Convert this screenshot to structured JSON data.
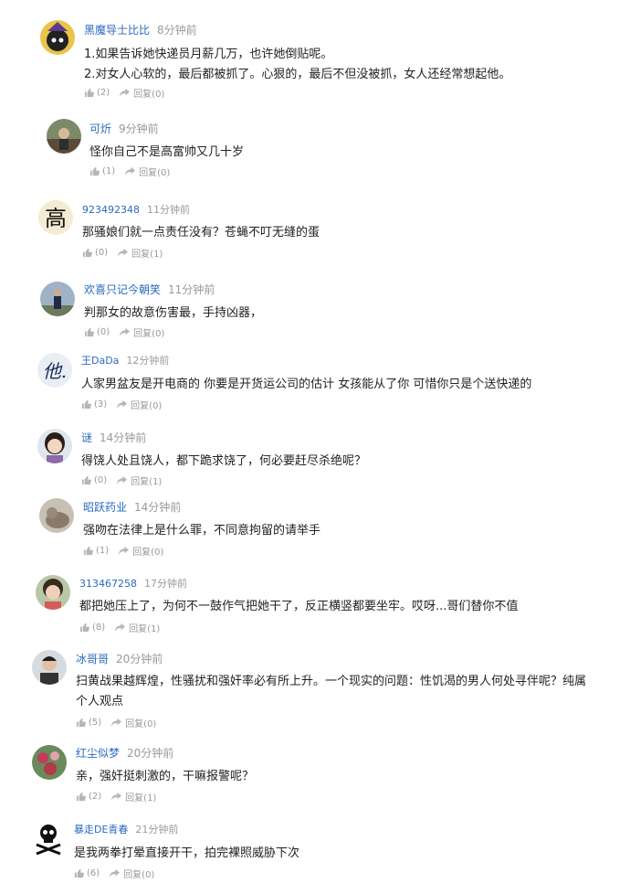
{
  "comments": [
    {
      "user": "黑魔导士比比",
      "time": "8分钟前",
      "lines": [
        "1.如果告诉她快递员月薪几万，也许她倒贴呢。",
        "2.对女人心软的，最后都被抓了。心狠的，最后不但没被抓，女人还经常想起他。"
      ],
      "likes": "(2)",
      "reply": "回复(0)",
      "avatar": "wizard"
    },
    {
      "user": "可炘",
      "time": "9分钟前",
      "lines": [
        "怪你自己不是高富帅又几十岁"
      ],
      "likes": "(1)",
      "reply": "回复(0)",
      "avatar": "photo"
    },
    {
      "user": "923492348",
      "time": "11分钟前",
      "lines": [
        "那骚娘们就一点责任没有？苍蝇不叮无缝的蛋"
      ],
      "likes": "(0)",
      "reply": "回复(1)",
      "avatar": "gao"
    },
    {
      "user": "欢喜只记今朝笑",
      "time": "11分钟前",
      "lines": [
        "判那女的故意伤害最，手持凶器，"
      ],
      "likes": "(0)",
      "reply": "回复(0)",
      "avatar": "person"
    },
    {
      "user": "王DaDa",
      "time": "12分钟前",
      "lines": [
        "人家男盆友是开电商的 你要是开货运公司的估计 女孩能从了你 可惜你只是个送快递的"
      ],
      "likes": "(3)",
      "reply": "回复(0)",
      "avatar": "ta"
    },
    {
      "user": "谜",
      "time": "14分钟前",
      "lines": [
        "得饶人处且饶人，都下跪求饶了，何必要赶尽杀绝呢？"
      ],
      "likes": "(0)",
      "reply": "回复(1)",
      "avatar": "girl"
    },
    {
      "user": "昭跃药业",
      "time": "14分钟前",
      "lines": [
        "强吻在法律上是什么罪，不同意拘留的请举手"
      ],
      "likes": "(1)",
      "reply": "回复(0)",
      "avatar": "cat"
    },
    {
      "user": "313467258",
      "time": "17分钟前",
      "lines": [
        "都把她压上了，为何不一鼓作气把她干了，反正横竖都要坐牢。哎呀...哥们替你不值"
      ],
      "likes": "(8)",
      "reply": "回复(1)",
      "avatar": "girl2"
    },
    {
      "user": "冰哥哥",
      "time": "20分钟前",
      "lines": [
        "扫黄战果越辉煌，性骚扰和强奸率必有所上升。一个现实的问题：性饥渴的男人何处寻伴呢？纯属个人观点"
      ],
      "likes": "(5)",
      "reply": "回复(0)",
      "avatar": "man"
    },
    {
      "user": "红尘似梦",
      "time": "20分钟前",
      "lines": [
        "亲，强奸挺刺激的，干嘛报警呢？"
      ],
      "likes": "(2)",
      "reply": "回复(1)",
      "avatar": "flowers"
    },
    {
      "user": "暴走DE青春",
      "time": "21分钟前",
      "lines": [
        "是我两拳打晕直接开干，拍完裸照威胁下次"
      ],
      "likes": "(6)",
      "reply": "回复(0)",
      "avatar": "skull"
    }
  ]
}
